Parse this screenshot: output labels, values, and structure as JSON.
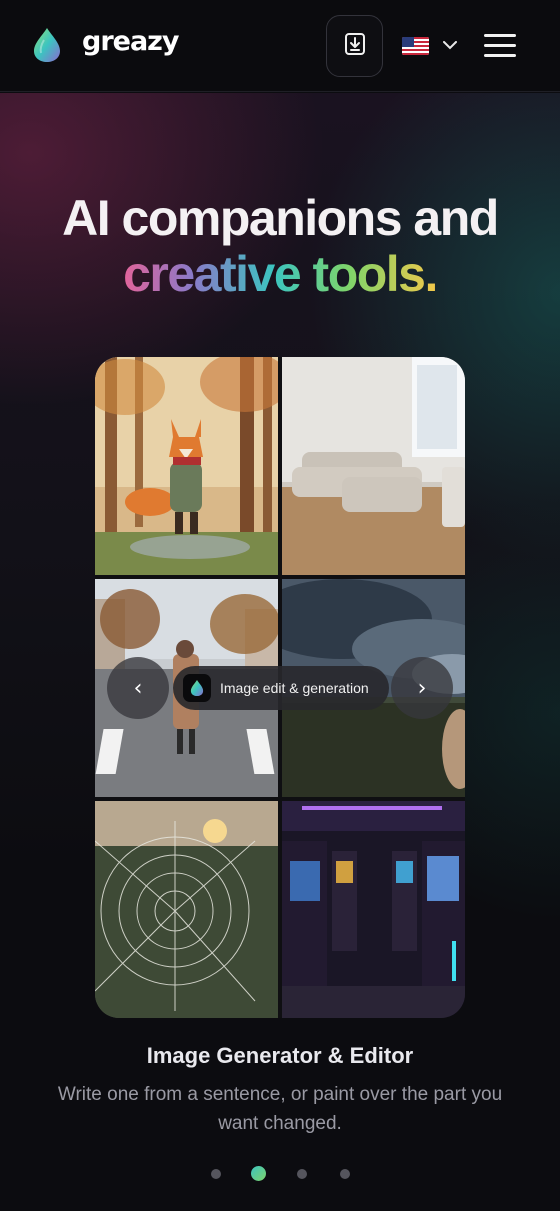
{
  "header": {
    "brand": "greazy",
    "download_icon": "download-icon",
    "language_flag": "us-flag-icon",
    "menu_icon": "hamburger-menu-icon"
  },
  "hero": {
    "headline_line1": "AI companions and",
    "headline_line2": "creative tools."
  },
  "gallery": {
    "tiles": [
      "fox-illustration",
      "empty-room-with-sofa",
      "woman-walking-on-crosswalk",
      "stormy-sky-over-field",
      "spider-web-at-sunset",
      "arcade-hall"
    ],
    "prev_label": "‹",
    "next_label": "›",
    "badge_label": "Image edit & generation"
  },
  "feature": {
    "title": "Image Generator & Editor",
    "description": "Write one from a sentence, or paint over the part you want changed."
  },
  "pagination": {
    "count": 4,
    "active_index": 1
  },
  "colors": {
    "background": "#0c0c10",
    "accent_teal": "#3cc4c0",
    "accent_green": "#7fd46a",
    "accent_pink": "#e2649a",
    "accent_yellow": "#f2c84a"
  }
}
